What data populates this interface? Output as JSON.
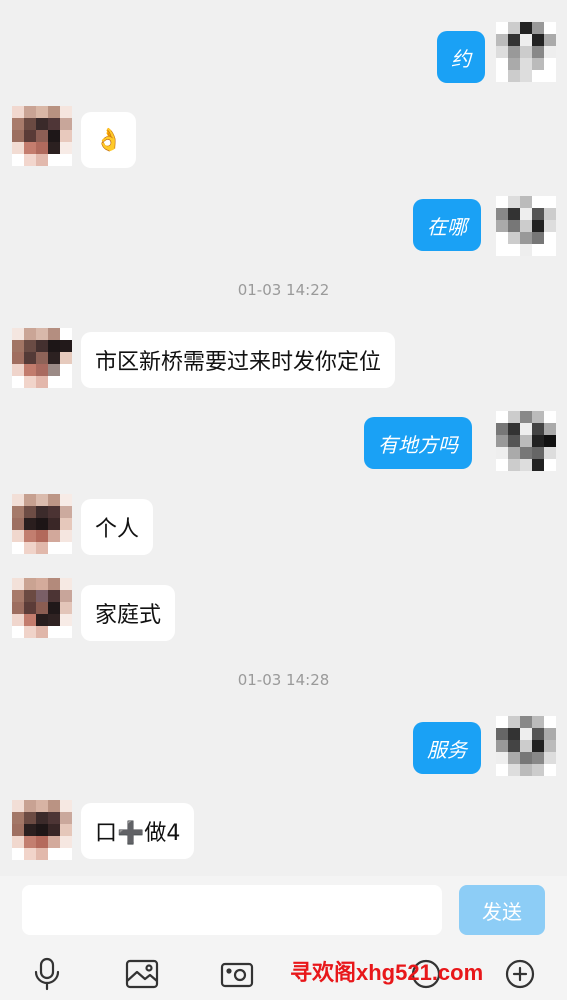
{
  "conversation": {
    "timestamps": [
      "01-03 14:22",
      "01-03 14:28"
    ],
    "messages": [
      {
        "side": "out",
        "text": "约"
      },
      {
        "side": "in",
        "text": "👌"
      },
      {
        "side": "out",
        "text": "在哪"
      },
      {
        "side": "in",
        "text": "市区新桥需要过来时发你定位"
      },
      {
        "side": "out",
        "text": "有地方吗"
      },
      {
        "side": "in",
        "text": "个人"
      },
      {
        "side": "in",
        "text": "家庭式"
      },
      {
        "side": "out",
        "text": "服务"
      },
      {
        "side": "in",
        "text": "口➕做4"
      }
    ]
  },
  "composer": {
    "input_value": "",
    "send_label": "发送"
  },
  "toolbar": {
    "icons": [
      "microphone-icon",
      "image-icon",
      "camera-icon",
      "emoji-icon",
      "add-icon"
    ]
  },
  "watermark": "寻欢阁xhg521.com",
  "colors": {
    "outgoing_bubble": "#1aa1f5",
    "incoming_bubble": "#ffffff",
    "background": "#f0f0f0",
    "send_button": "#8dcdf6",
    "watermark": "#e8171a"
  }
}
